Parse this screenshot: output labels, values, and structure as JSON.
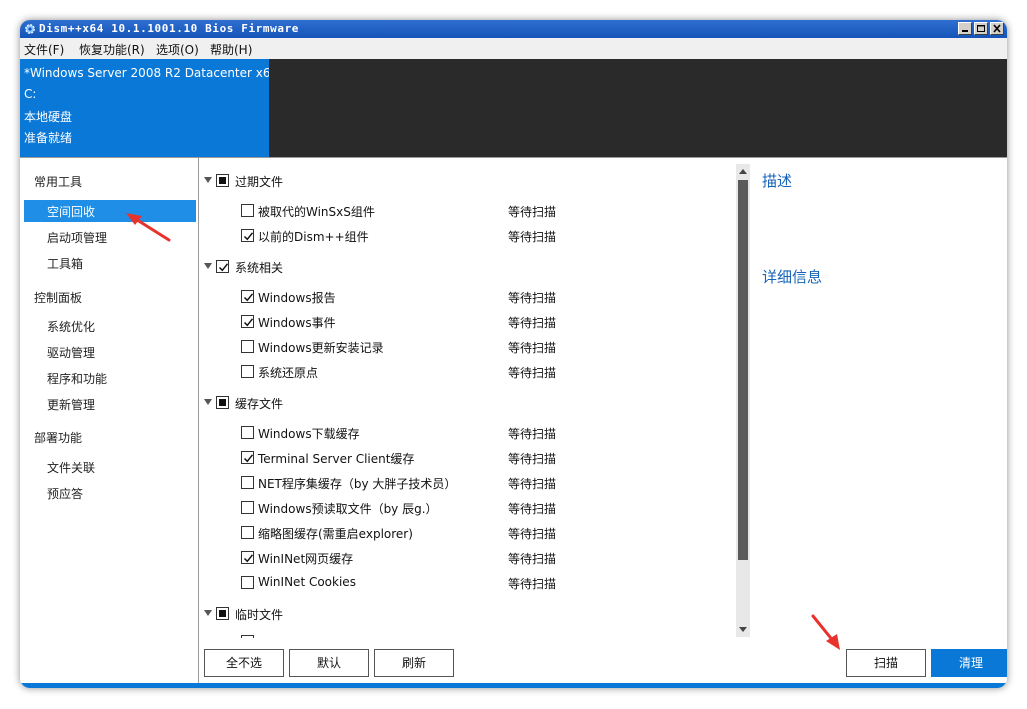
{
  "window": {
    "title": "Dism++x64 10.1.1001.10 Bios Firmware"
  },
  "menu": [
    {
      "label": "文件(F)"
    },
    {
      "label": "恢复功能(R)"
    },
    {
      "label": "选项(O)"
    },
    {
      "label": "帮助(H)"
    }
  ],
  "header": {
    "lines": [
      "*Windows Server 2008 R2 Datacenter x64",
      "C:",
      "本地硬盘",
      "准备就绪"
    ]
  },
  "sidebar": {
    "groups": [
      {
        "label": "常用工具",
        "items": [
          {
            "label": "空间回收",
            "selected": true
          },
          {
            "label": "启动项管理"
          },
          {
            "label": "工具箱"
          }
        ]
      },
      {
        "label": "控制面板",
        "items": [
          {
            "label": "系统优化"
          },
          {
            "label": "驱动管理"
          },
          {
            "label": "程序和功能"
          },
          {
            "label": "更新管理"
          }
        ]
      },
      {
        "label": "部署功能",
        "items": [
          {
            "label": "文件关联"
          },
          {
            "label": "预应答"
          }
        ]
      }
    ]
  },
  "categories": [
    {
      "label": "过期文件",
      "state": "partial",
      "items": [
        {
          "label": "被取代的WinSxS组件",
          "checked": false,
          "status": "等待扫描"
        },
        {
          "label": "以前的Dism++组件",
          "checked": true,
          "status": "等待扫描"
        }
      ]
    },
    {
      "label": "系统相关",
      "state": "checked",
      "items": [
        {
          "label": "Windows报告",
          "checked": true,
          "status": "等待扫描"
        },
        {
          "label": "Windows事件",
          "checked": true,
          "status": "等待扫描"
        },
        {
          "label": "Windows更新安装记录",
          "checked": false,
          "status": "等待扫描"
        },
        {
          "label": "系统还原点",
          "checked": false,
          "status": "等待扫描"
        }
      ]
    },
    {
      "label": "缓存文件",
      "state": "partial",
      "items": [
        {
          "label": "Windows下载缓存",
          "checked": false,
          "status": "等待扫描"
        },
        {
          "label": "Terminal Server Client缓存",
          "checked": true,
          "status": "等待扫描"
        },
        {
          "label": "NET程序集缓存（by 大胖子技术员）",
          "checked": false,
          "status": "等待扫描"
        },
        {
          "label": "Windows预读取文件（by 辰g.）",
          "checked": false,
          "status": "等待扫描"
        },
        {
          "label": "缩略图缓存(需重启explorer)",
          "checked": false,
          "status": "等待扫描"
        },
        {
          "label": "WinINet网页缓存",
          "checked": true,
          "status": "等待扫描"
        },
        {
          "label": "WinINet Cookies",
          "checked": false,
          "status": "等待扫描"
        }
      ]
    },
    {
      "label": "临时文件",
      "state": "partial",
      "items": []
    }
  ],
  "panel": {
    "description_title": "描述",
    "details_title": "详细信息"
  },
  "buttons": {
    "deselect_all": "全不选",
    "default": "默认",
    "refresh": "刷新",
    "scan": "扫描",
    "clean": "清理"
  },
  "colors": {
    "accent": "#0a78d7",
    "selection": "#1e8ee6",
    "annotation_arrow": "#e8332d"
  }
}
